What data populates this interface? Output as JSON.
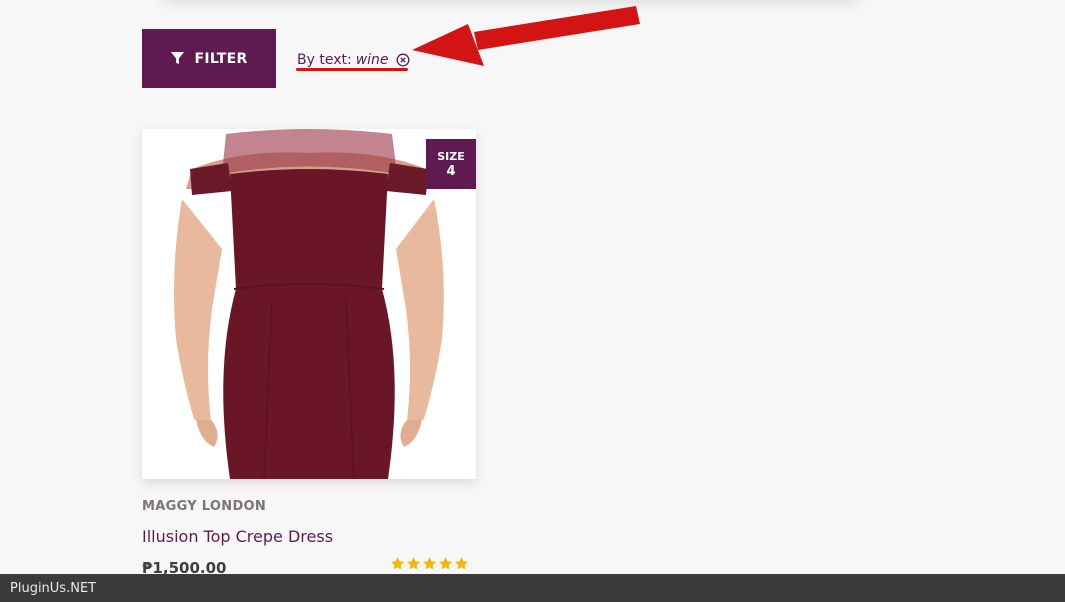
{
  "toolbar": {
    "filter_button_label": "FILTER"
  },
  "active_filter": {
    "label": "By text:",
    "value": "wine"
  },
  "product": {
    "brand": "MAGGY LONDON",
    "title": "Illusion Top Crepe Dress",
    "price": "₱1,500.00",
    "badge_line1": "SIZE",
    "badge_line2": "4",
    "rating": 5,
    "rating_max": 5
  },
  "footer": {
    "watermark": "PluginUs.NET"
  },
  "colors": {
    "accent": "#5f1a52",
    "annotation": "#d41414",
    "star": "#f5b800",
    "footer_bg": "#3a3a3a"
  },
  "icons": {
    "filter": "funnel-icon",
    "remove_filter": "circle-x-icon",
    "annotation": "red-arrow-icon",
    "star": "star-icon"
  }
}
